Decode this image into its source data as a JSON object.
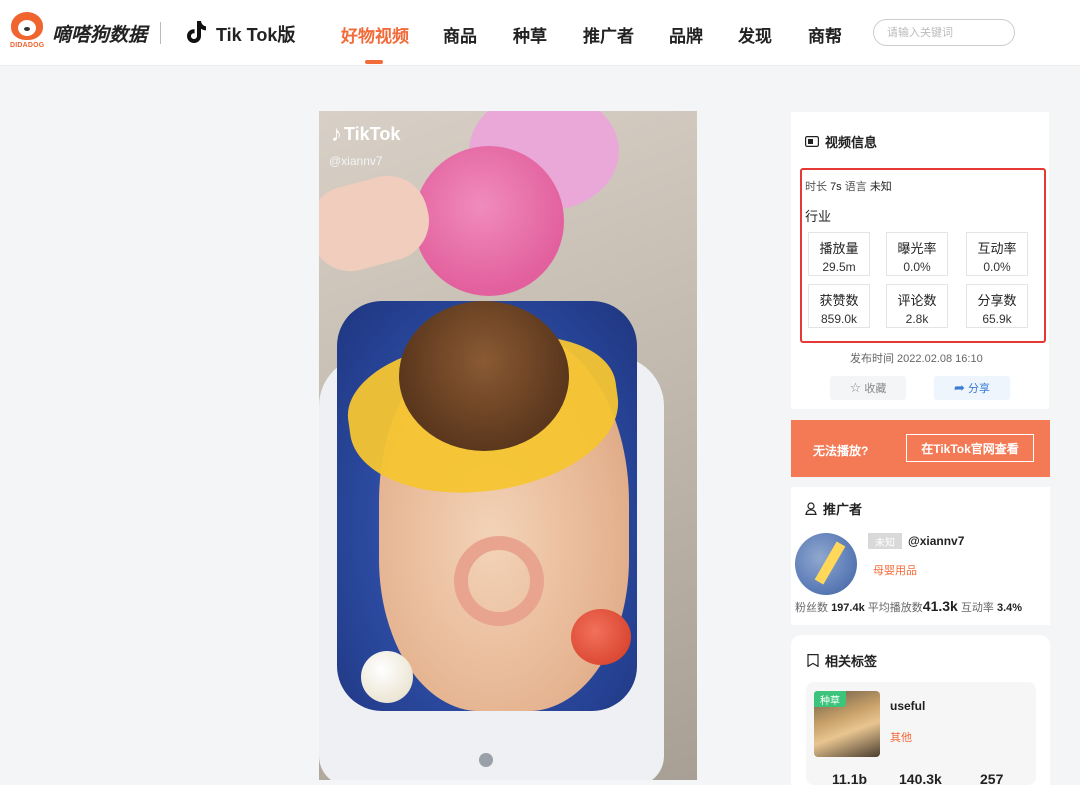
{
  "header": {
    "logo_sub": "DIDADOG",
    "brand": "嘀嗒狗数据",
    "edition": "Tik Tok版",
    "nav": [
      "好物视频",
      "商品",
      "种草",
      "推广者",
      "品牌",
      "发现",
      "商帮"
    ],
    "active_nav": "好物视频",
    "search_placeholder": "请输入关键词",
    "accent_color": "#f26b3a"
  },
  "video": {
    "watermark": "TikTok",
    "handle": "@xiannv7"
  },
  "video_info": {
    "title": "视频信息",
    "duration_label": "时长",
    "duration": "7s",
    "language_label": "语言",
    "language": "未知",
    "industry_label": "行业",
    "stats": [
      {
        "label": "播放量",
        "value": "29.5m"
      },
      {
        "label": "曝光率",
        "value": "0.0%"
      },
      {
        "label": "互动率",
        "value": "0.0%"
      },
      {
        "label": "获赞数",
        "value": "859.0k"
      },
      {
        "label": "评论数",
        "value": "2.8k"
      },
      {
        "label": "分享数",
        "value": "65.9k"
      }
    ],
    "publish_time": "发布时间 2022.02.08 16:10",
    "collect_label": "收藏",
    "share_label": "分享"
  },
  "playback": {
    "cannot_play": "无法播放?",
    "view_on_tiktok": "在TikTok官网查看"
  },
  "promoter": {
    "title": "推广者",
    "tag": "未知",
    "handle": "@xiannv7",
    "category": "母婴用品",
    "followers_label": "粉丝数",
    "followers": "197.4k",
    "avg_plays_label": "平均播放数",
    "avg_plays": "41.3k",
    "engagement_label": "互动率",
    "engagement": "3.4%"
  },
  "tags": {
    "title": "相关标签",
    "items": [
      {
        "badge": "种草",
        "name": "useful",
        "category": "其他",
        "stats": [
          "11.1b",
          "140.3k",
          "257"
        ]
      }
    ]
  }
}
